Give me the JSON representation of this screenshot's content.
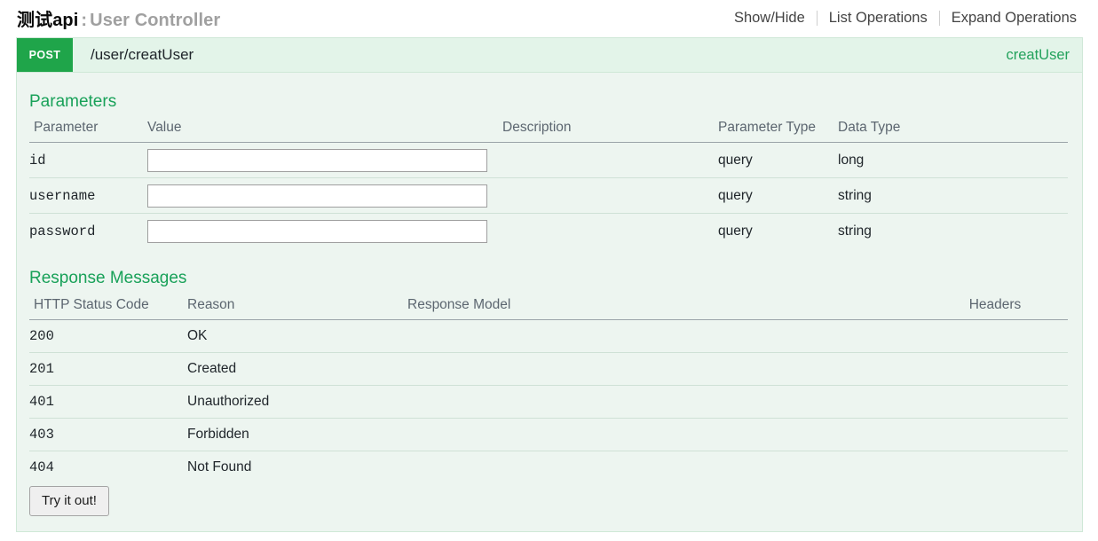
{
  "resource": {
    "name": "测试api",
    "separator": ":",
    "description": "User Controller",
    "options": [
      {
        "label": "Show/Hide"
      },
      {
        "label": "List Operations"
      },
      {
        "label": "Expand Operations"
      }
    ]
  },
  "operation": {
    "method": "POST",
    "path": "/user/creatUser",
    "nickname": "creatUser",
    "parameters_title": "Parameters",
    "parameters_headers": [
      "Parameter",
      "Value",
      "Description",
      "Parameter Type",
      "Data Type"
    ],
    "parameters": [
      {
        "name": "id",
        "value": "",
        "placeholder": "",
        "description": "",
        "param_type": "query",
        "data_type": "long"
      },
      {
        "name": "username",
        "value": "",
        "placeholder": "",
        "description": "",
        "param_type": "query",
        "data_type": "string"
      },
      {
        "name": "password",
        "value": "",
        "placeholder": "",
        "description": "",
        "param_type": "query",
        "data_type": "string"
      }
    ],
    "responses_title": "Response Messages",
    "responses_headers": [
      "HTTP Status Code",
      "Reason",
      "Response Model",
      "Headers"
    ],
    "responses": [
      {
        "code": "200",
        "reason": "OK",
        "model": "",
        "headers": ""
      },
      {
        "code": "201",
        "reason": "Created",
        "model": "",
        "headers": ""
      },
      {
        "code": "401",
        "reason": "Unauthorized",
        "model": "",
        "headers": ""
      },
      {
        "code": "403",
        "reason": "Forbidden",
        "model": "",
        "headers": ""
      },
      {
        "code": "404",
        "reason": "Not Found",
        "model": "",
        "headers": ""
      }
    ],
    "submit_label": "Try it out!"
  },
  "colors": {
    "method_post": "#1fa54a",
    "section_heading": "#19a159",
    "nickname_link": "#23a25c",
    "panel_bg": "#edf5f0",
    "op_bar_bg": "#e3f4e9",
    "panel_border": "#cfe8d7"
  }
}
